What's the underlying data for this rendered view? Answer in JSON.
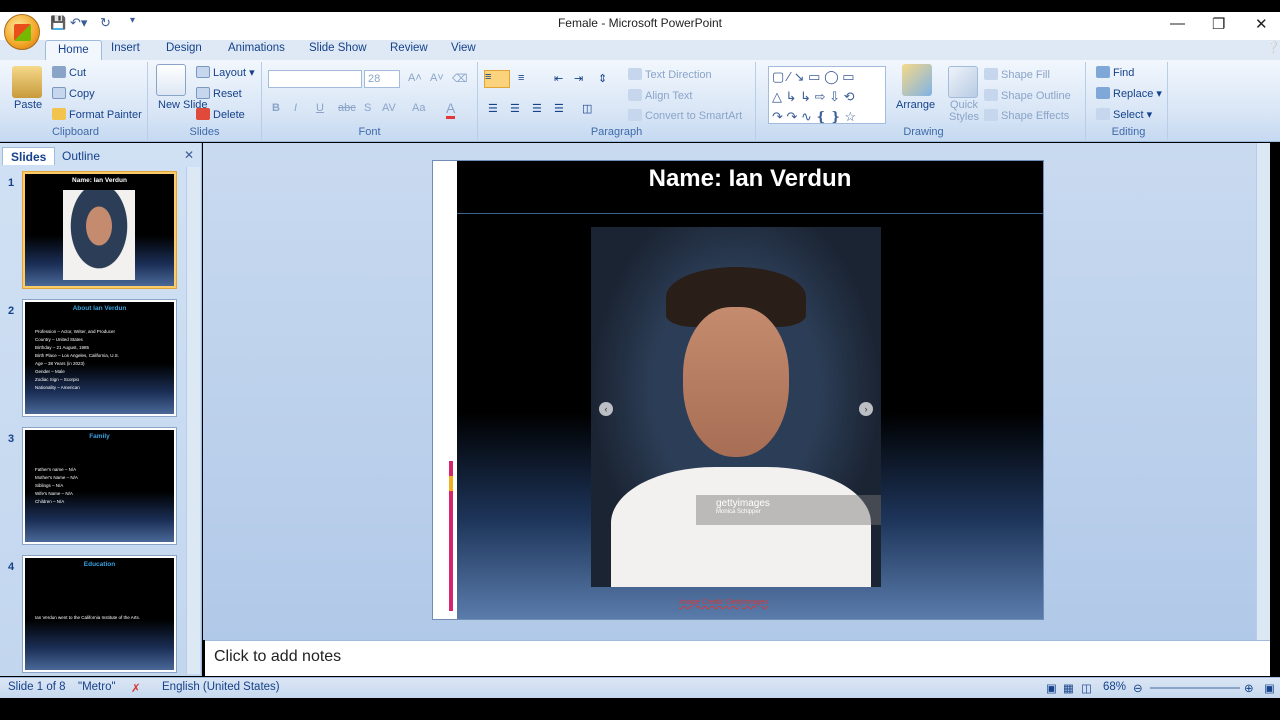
{
  "window": {
    "title": "Female - Microsoft PowerPoint"
  },
  "tabs": [
    "Home",
    "Insert",
    "Design",
    "Animations",
    "Slide Show",
    "Review",
    "View"
  ],
  "ribbon": {
    "clipboard": {
      "label": "Clipboard",
      "paste": "Paste",
      "cut": "Cut",
      "copy": "Copy",
      "format_painter": "Format Painter"
    },
    "slides": {
      "label": "Slides",
      "new_slide": "New Slide",
      "layout": "Layout",
      "reset": "Reset",
      "delete": "Delete"
    },
    "font": {
      "label": "Font",
      "name": "",
      "size": "28",
      "bold": "B",
      "italic": "I",
      "underline": "U",
      "strike": "abc",
      "shadow": "S",
      "spacing": "AV",
      "case": "Aa",
      "color": "A"
    },
    "paragraph": {
      "label": "Paragraph",
      "text_direction": "Text Direction",
      "align_text": "Align Text",
      "convert_smartart": "Convert to SmartArt"
    },
    "drawing": {
      "label": "Drawing",
      "arrange": "Arrange",
      "quick_styles": "Quick Styles",
      "shape_fill": "Shape Fill",
      "shape_outline": "Shape Outline",
      "shape_effects": "Shape Effects"
    },
    "editing": {
      "label": "Editing",
      "find": "Find",
      "replace": "Replace",
      "select": "Select"
    }
  },
  "left_pane": {
    "tab_slides": "Slides",
    "tab_outline": "Outline",
    "thumbnails": [
      {
        "num": "1",
        "title": "Name: Ian Verdun",
        "bullets": []
      },
      {
        "num": "2",
        "title": "About Ian Verdun",
        "bullets": [
          "Profession – Actor, Writer, and Producer",
          "Country – United States",
          "Birthday – 21 August, 1985",
          "Birth Place – Los Angeles, California, U.S.",
          "Age – 38 Years (in 2023)",
          "Gender – Male",
          "Zodiac Sign – Scorpio",
          "Nationality – American"
        ]
      },
      {
        "num": "3",
        "title": "Family",
        "bullets": [
          "Father's name – N/A",
          "Mother's Name – N/A",
          "Siblings – N/A",
          "Wife's Name – N/A",
          "Children – N/A"
        ]
      },
      {
        "num": "4",
        "title": "Education",
        "bullets": [
          "Ian Verdun went to the California Institute of the Arts."
        ]
      }
    ]
  },
  "slide": {
    "title": "Name: Ian Verdun",
    "watermark": "gettyimages",
    "watermark_credit": "Monica Schipper",
    "credit": "Image Credit: Gettyimages"
  },
  "notes_placeholder": "Click to add notes",
  "status": {
    "slide_pos": "Slide 1 of 8",
    "theme": "\"Metro\"",
    "language": "English (United States)",
    "zoom": "68%"
  }
}
